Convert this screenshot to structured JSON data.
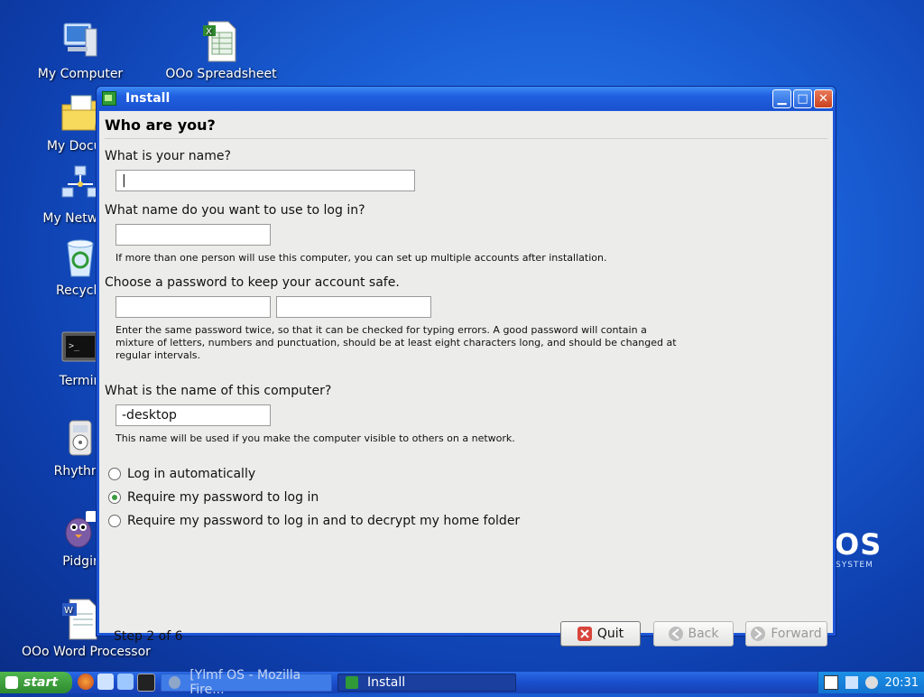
{
  "desktop": {
    "icons": [
      {
        "label": "My Computer",
        "icon": "computer-icon"
      },
      {
        "label": "OOo Spreadsheet",
        "icon": "spreadsheet-icon"
      },
      {
        "label": "My Docum",
        "icon": "documents-folder-icon"
      },
      {
        "label": "My Network",
        "icon": "network-icon"
      },
      {
        "label": "Recycle",
        "icon": "recycle-bin-icon"
      },
      {
        "label": "Termin",
        "icon": "terminal-icon"
      },
      {
        "label": "Rhythml",
        "icon": "rhythmbox-icon"
      },
      {
        "label": "Pidgir",
        "icon": "pidgin-icon"
      },
      {
        "label": "OOo Word Processor",
        "icon": "word-processor-icon"
      }
    ],
    "brand": {
      "text": "OS",
      "sub": "SYSTEM"
    }
  },
  "window": {
    "title": "Install",
    "heading": "Who are you?",
    "name_question": "What is your name?",
    "name_value": "|",
    "login_question": "What name do you want to use to log in?",
    "login_value": "",
    "login_hint": "If more than one person will use this computer, you can set up multiple accounts after installation.",
    "password_question": "Choose a password to keep your account safe.",
    "password_hint_1": "Enter the same password twice, so that it can be checked for typing errors. A good password will contain a",
    "password_hint_2": "mixture of letters, numbers and punctuation, should be at least eight characters long, and should be changed at",
    "password_hint_3": "regular intervals.",
    "computer_question": "What is the name of this computer?",
    "computer_value": "-desktop",
    "computer_hint": "This name will be used if you make the computer visible to others on a network.",
    "login_options": [
      {
        "label": "Log in automatically",
        "selected": false
      },
      {
        "label": "Require my password to log in",
        "selected": true
      },
      {
        "label": "Require my password to log in and to decrypt my home folder",
        "selected": false
      }
    ],
    "step": "Step 2 of 6",
    "buttons": {
      "quit": "Quit",
      "back": "Back",
      "forward": "Forward"
    }
  },
  "taskbar": {
    "start": "start",
    "tasks": [
      "[Ylmf OS - Mozilla Fire...",
      "Install"
    ],
    "clock": "20:31"
  }
}
